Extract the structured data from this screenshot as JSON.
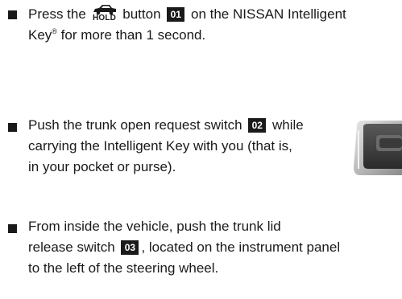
{
  "item1": {
    "before_icon": "Press the ",
    "icon_label": "HOLD",
    "after_icon": " button ",
    "badge": "01",
    "after_badge": " on the NISSAN Intelligent",
    "line2_a": "Key",
    "line2_reg": "®",
    "line2_b": " for more than 1 second."
  },
  "item2": {
    "line1_before": "Push the trunk open request switch ",
    "badge": "02",
    "line1_after": " while",
    "line2": "carrying the Intelligent Key with you (that is,",
    "line3": "in your pocket or purse)."
  },
  "item3": {
    "line1": "From inside the vehicle, push the trunk lid",
    "line2_before": "release switch ",
    "badge": "03",
    "line2_after": ", located on the instrument panel",
    "line3": "to the left of the steering wheel."
  },
  "icons": {
    "hold": "trunk-hold-icon",
    "thumbnail": "switch-photo-thumbnail"
  }
}
